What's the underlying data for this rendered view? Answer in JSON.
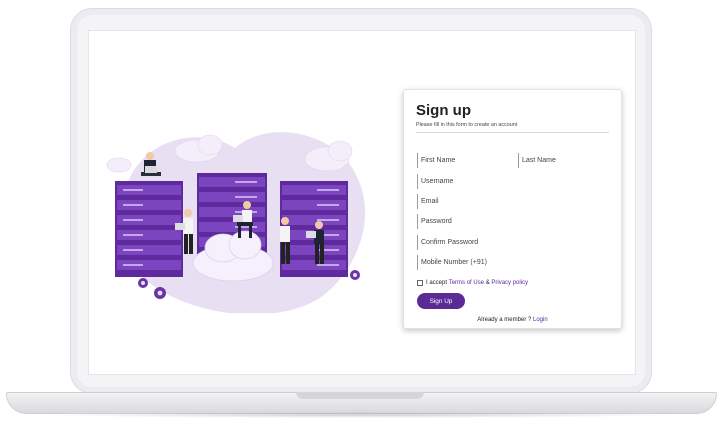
{
  "form": {
    "title": "Sign up",
    "subtitle": "Please fill in this form to create an account",
    "fields": {
      "first_name": "First Name",
      "last_name": "Last Name",
      "username": "Username",
      "email": "Email",
      "password": "Password",
      "confirm_password": "Confirm Password",
      "mobile": "Mobile Number (+91)"
    },
    "terms_prefix": "I accept ",
    "terms_link": "Terms of Use",
    "terms_and": " & ",
    "privacy_link": "Privacy policy",
    "signup_label": "Sign Up",
    "member_text": "Already a member ? ",
    "login_link": "Login"
  },
  "colors": {
    "accent": "#5b2a94",
    "server": "#5f2a9e",
    "blob": "#e6dcf3"
  }
}
